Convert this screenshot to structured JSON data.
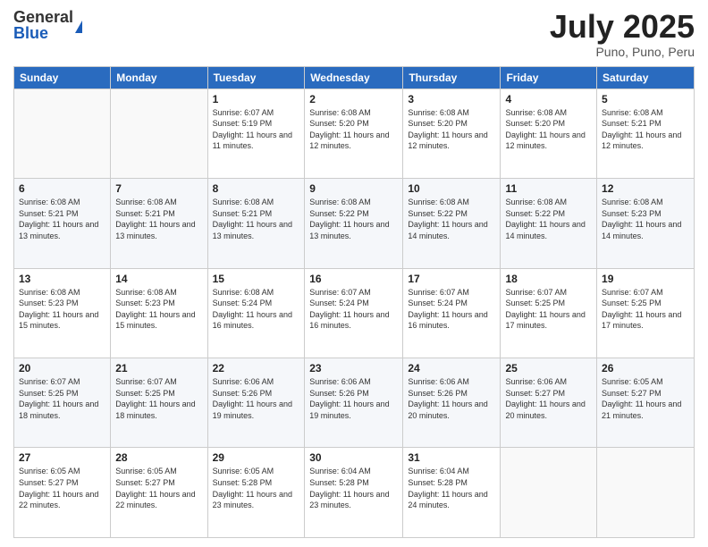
{
  "logo": {
    "general": "General",
    "blue": "Blue"
  },
  "title": {
    "month": "July 2025",
    "location": "Puno, Puno, Peru"
  },
  "weekdays": [
    "Sunday",
    "Monday",
    "Tuesday",
    "Wednesday",
    "Thursday",
    "Friday",
    "Saturday"
  ],
  "weeks": [
    [
      {
        "day": "",
        "sunrise": "",
        "sunset": "",
        "daylight": ""
      },
      {
        "day": "",
        "sunrise": "",
        "sunset": "",
        "daylight": ""
      },
      {
        "day": "1",
        "sunrise": "Sunrise: 6:07 AM",
        "sunset": "Sunset: 5:19 PM",
        "daylight": "Daylight: 11 hours and 11 minutes."
      },
      {
        "day": "2",
        "sunrise": "Sunrise: 6:08 AM",
        "sunset": "Sunset: 5:20 PM",
        "daylight": "Daylight: 11 hours and 12 minutes."
      },
      {
        "day": "3",
        "sunrise": "Sunrise: 6:08 AM",
        "sunset": "Sunset: 5:20 PM",
        "daylight": "Daylight: 11 hours and 12 minutes."
      },
      {
        "day": "4",
        "sunrise": "Sunrise: 6:08 AM",
        "sunset": "Sunset: 5:20 PM",
        "daylight": "Daylight: 11 hours and 12 minutes."
      },
      {
        "day": "5",
        "sunrise": "Sunrise: 6:08 AM",
        "sunset": "Sunset: 5:21 PM",
        "daylight": "Daylight: 11 hours and 12 minutes."
      }
    ],
    [
      {
        "day": "6",
        "sunrise": "Sunrise: 6:08 AM",
        "sunset": "Sunset: 5:21 PM",
        "daylight": "Daylight: 11 hours and 13 minutes."
      },
      {
        "day": "7",
        "sunrise": "Sunrise: 6:08 AM",
        "sunset": "Sunset: 5:21 PM",
        "daylight": "Daylight: 11 hours and 13 minutes."
      },
      {
        "day": "8",
        "sunrise": "Sunrise: 6:08 AM",
        "sunset": "Sunset: 5:21 PM",
        "daylight": "Daylight: 11 hours and 13 minutes."
      },
      {
        "day": "9",
        "sunrise": "Sunrise: 6:08 AM",
        "sunset": "Sunset: 5:22 PM",
        "daylight": "Daylight: 11 hours and 13 minutes."
      },
      {
        "day": "10",
        "sunrise": "Sunrise: 6:08 AM",
        "sunset": "Sunset: 5:22 PM",
        "daylight": "Daylight: 11 hours and 14 minutes."
      },
      {
        "day": "11",
        "sunrise": "Sunrise: 6:08 AM",
        "sunset": "Sunset: 5:22 PM",
        "daylight": "Daylight: 11 hours and 14 minutes."
      },
      {
        "day": "12",
        "sunrise": "Sunrise: 6:08 AM",
        "sunset": "Sunset: 5:23 PM",
        "daylight": "Daylight: 11 hours and 14 minutes."
      }
    ],
    [
      {
        "day": "13",
        "sunrise": "Sunrise: 6:08 AM",
        "sunset": "Sunset: 5:23 PM",
        "daylight": "Daylight: 11 hours and 15 minutes."
      },
      {
        "day": "14",
        "sunrise": "Sunrise: 6:08 AM",
        "sunset": "Sunset: 5:23 PM",
        "daylight": "Daylight: 11 hours and 15 minutes."
      },
      {
        "day": "15",
        "sunrise": "Sunrise: 6:08 AM",
        "sunset": "Sunset: 5:24 PM",
        "daylight": "Daylight: 11 hours and 16 minutes."
      },
      {
        "day": "16",
        "sunrise": "Sunrise: 6:07 AM",
        "sunset": "Sunset: 5:24 PM",
        "daylight": "Daylight: 11 hours and 16 minutes."
      },
      {
        "day": "17",
        "sunrise": "Sunrise: 6:07 AM",
        "sunset": "Sunset: 5:24 PM",
        "daylight": "Daylight: 11 hours and 16 minutes."
      },
      {
        "day": "18",
        "sunrise": "Sunrise: 6:07 AM",
        "sunset": "Sunset: 5:25 PM",
        "daylight": "Daylight: 11 hours and 17 minutes."
      },
      {
        "day": "19",
        "sunrise": "Sunrise: 6:07 AM",
        "sunset": "Sunset: 5:25 PM",
        "daylight": "Daylight: 11 hours and 17 minutes."
      }
    ],
    [
      {
        "day": "20",
        "sunrise": "Sunrise: 6:07 AM",
        "sunset": "Sunset: 5:25 PM",
        "daylight": "Daylight: 11 hours and 18 minutes."
      },
      {
        "day": "21",
        "sunrise": "Sunrise: 6:07 AM",
        "sunset": "Sunset: 5:25 PM",
        "daylight": "Daylight: 11 hours and 18 minutes."
      },
      {
        "day": "22",
        "sunrise": "Sunrise: 6:06 AM",
        "sunset": "Sunset: 5:26 PM",
        "daylight": "Daylight: 11 hours and 19 minutes."
      },
      {
        "day": "23",
        "sunrise": "Sunrise: 6:06 AM",
        "sunset": "Sunset: 5:26 PM",
        "daylight": "Daylight: 11 hours and 19 minutes."
      },
      {
        "day": "24",
        "sunrise": "Sunrise: 6:06 AM",
        "sunset": "Sunset: 5:26 PM",
        "daylight": "Daylight: 11 hours and 20 minutes."
      },
      {
        "day": "25",
        "sunrise": "Sunrise: 6:06 AM",
        "sunset": "Sunset: 5:27 PM",
        "daylight": "Daylight: 11 hours and 20 minutes."
      },
      {
        "day": "26",
        "sunrise": "Sunrise: 6:05 AM",
        "sunset": "Sunset: 5:27 PM",
        "daylight": "Daylight: 11 hours and 21 minutes."
      }
    ],
    [
      {
        "day": "27",
        "sunrise": "Sunrise: 6:05 AM",
        "sunset": "Sunset: 5:27 PM",
        "daylight": "Daylight: 11 hours and 22 minutes."
      },
      {
        "day": "28",
        "sunrise": "Sunrise: 6:05 AM",
        "sunset": "Sunset: 5:27 PM",
        "daylight": "Daylight: 11 hours and 22 minutes."
      },
      {
        "day": "29",
        "sunrise": "Sunrise: 6:05 AM",
        "sunset": "Sunset: 5:28 PM",
        "daylight": "Daylight: 11 hours and 23 minutes."
      },
      {
        "day": "30",
        "sunrise": "Sunrise: 6:04 AM",
        "sunset": "Sunset: 5:28 PM",
        "daylight": "Daylight: 11 hours and 23 minutes."
      },
      {
        "day": "31",
        "sunrise": "Sunrise: 6:04 AM",
        "sunset": "Sunset: 5:28 PM",
        "daylight": "Daylight: 11 hours and 24 minutes."
      },
      {
        "day": "",
        "sunrise": "",
        "sunset": "",
        "daylight": ""
      },
      {
        "day": "",
        "sunrise": "",
        "sunset": "",
        "daylight": ""
      }
    ]
  ]
}
